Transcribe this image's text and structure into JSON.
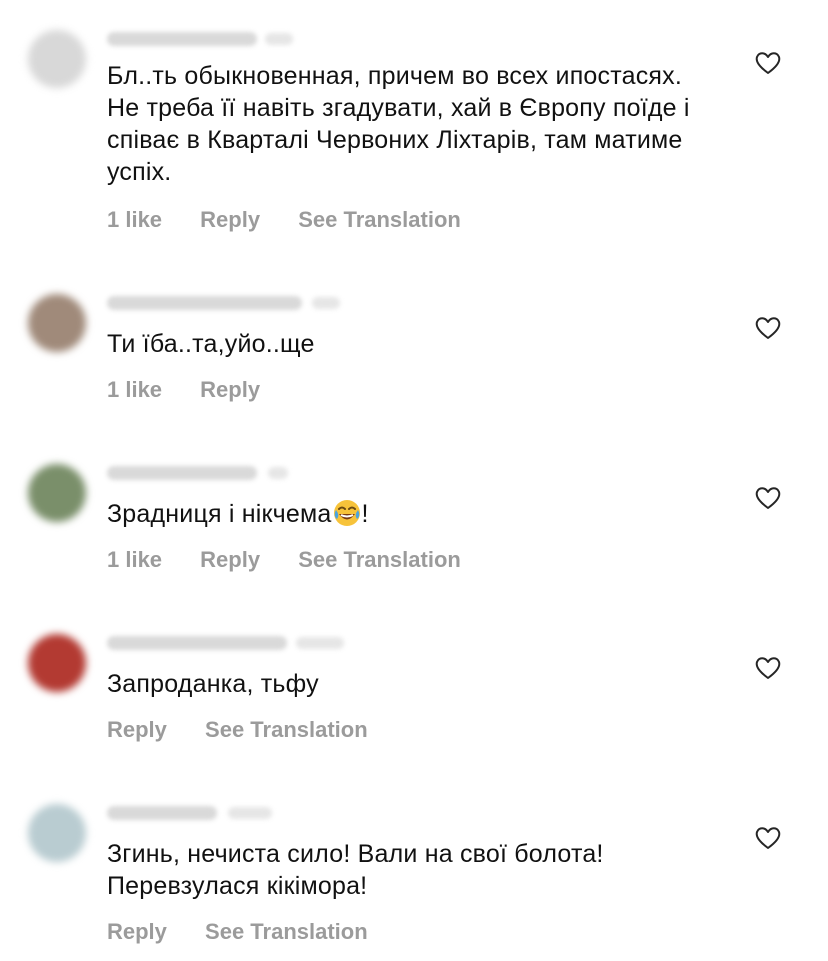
{
  "comments": [
    {
      "text": "Бл..ть обыкновенная, причем во всех ипостасях. Не треба її навіть згадувати, хай в Європу поїде і співає в Кварталі Червоних Ліхтарів, там матиме успіх.",
      "likes": "1 like",
      "reply": "Reply",
      "translate": "See Translation",
      "avatar_color": "#d8d8d8"
    },
    {
      "text": "Ти їба..та,уйо..ще",
      "likes": "1 like",
      "reply": "Reply",
      "avatar_color": "#a08a7a"
    },
    {
      "text": "Зрадниця і нікчема",
      "text_suffix": "!",
      "emoji": "face-with-tears-of-joy",
      "likes": "1 like",
      "reply": "Reply",
      "translate": "See Translation",
      "avatar_color": "#7a8f6a"
    },
    {
      "text": "Запроданка, тьфу",
      "reply": "Reply",
      "translate": "See Translation",
      "avatar_color": "#b33a32"
    },
    {
      "text": "Згинь, нечиста сило! Вали на свої болота! Перевзулася кікімора!",
      "reply": "Reply",
      "translate": "See Translation",
      "avatar_color": "#b9ccd1"
    }
  ],
  "icons": {
    "like": "heart-outline-icon"
  }
}
